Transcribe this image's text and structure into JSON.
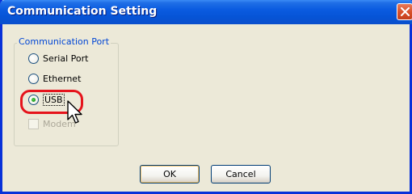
{
  "window": {
    "title": "Communication Setting"
  },
  "group": {
    "legend": "Communication Port",
    "options": [
      {
        "label": "Serial Port",
        "selected": false
      },
      {
        "label": "Ethernet",
        "selected": false
      },
      {
        "label": "USB",
        "selected": true
      }
    ],
    "modem": {
      "label": "Modem",
      "checked": false,
      "enabled": false
    }
  },
  "buttons": {
    "ok": "OK",
    "cancel": "Cancel"
  },
  "colors": {
    "titlebar": "#0a5be0",
    "dialog_bg": "#ece9d8",
    "legend_text": "#0046d5",
    "highlight": "#e5141c"
  }
}
